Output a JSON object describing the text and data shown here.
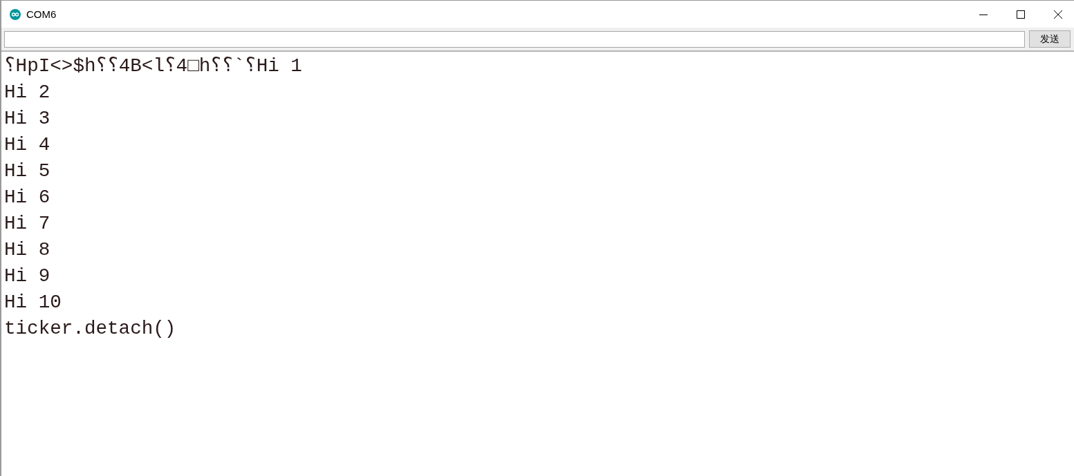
{
  "window": {
    "title": "COM6"
  },
  "input": {
    "button": "发送"
  },
  "output": {
    "lines": [
      "⸮HpI<>$h⸮⸮4B<l⸮4□h⸮⸮`⸮Hi 1",
      "Hi 2",
      "Hi 3",
      "Hi 4",
      "Hi 5",
      "Hi 6",
      "Hi 7",
      "Hi 8",
      "Hi 9",
      "Hi 10",
      "ticker.detach()"
    ]
  }
}
